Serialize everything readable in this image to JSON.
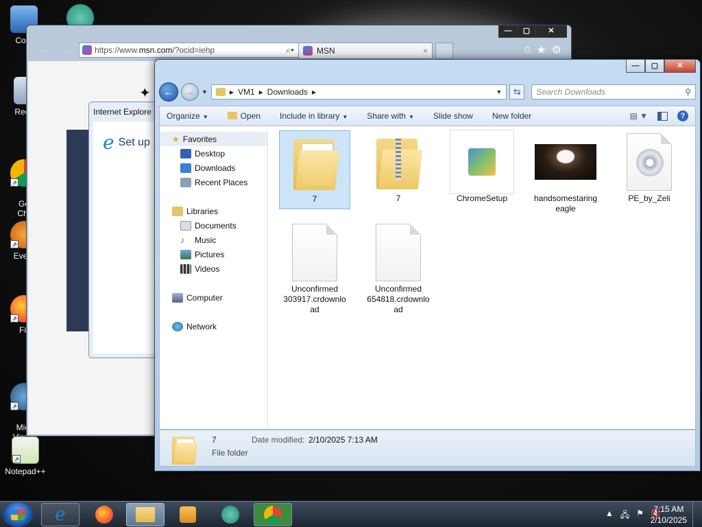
{
  "desktop": {
    "icons": [
      {
        "label": "Com"
      },
      {
        "label": "Recy"
      },
      {
        "label": "Go\nChr"
      },
      {
        "label": "Every"
      },
      {
        "label": "Fir"
      },
      {
        "label": "Micr\nVisual"
      },
      {
        "label": "Notepad++"
      }
    ]
  },
  "ie": {
    "url_prefix": "https://www.",
    "url_domain": "msn.com",
    "url_suffix": "/?ocid=iehp",
    "tab_title": "MSN",
    "tab_close": "×",
    "dialog_title": "Internet Explore",
    "setup_text": "Set up"
  },
  "explorer": {
    "breadcrumb": [
      "VM1",
      "Downloads"
    ],
    "search_placeholder": "Search Downloads",
    "toolbar": {
      "organize": "Organize",
      "open": "Open",
      "include": "Include in library",
      "share": "Share with",
      "slideshow": "Slide show",
      "newfolder": "New folder"
    },
    "nav": {
      "favorites": "Favorites",
      "desktop": "Desktop",
      "downloads": "Downloads",
      "recent": "Recent Places",
      "libraries": "Libraries",
      "documents": "Documents",
      "music": "Music",
      "pictures": "Pictures",
      "videos": "Videos",
      "computer": "Computer",
      "network": "Network"
    },
    "files": [
      {
        "name": "7"
      },
      {
        "name": "7"
      },
      {
        "name": "ChromeSetup"
      },
      {
        "name": "handsomestaring eagle"
      },
      {
        "name": "PE_by_Zeli"
      },
      {
        "name": "Unconfirmed 303917.crdownlo ad"
      },
      {
        "name": "Unconfirmed 654818.crdownlo ad"
      }
    ],
    "details": {
      "name": "7",
      "type": "File folder",
      "date_label": "Date modified:",
      "date_value": "2/10/2025 7:13 AM"
    }
  },
  "taskbar": {
    "time": "7:15 AM",
    "date": "2/10/2025"
  }
}
